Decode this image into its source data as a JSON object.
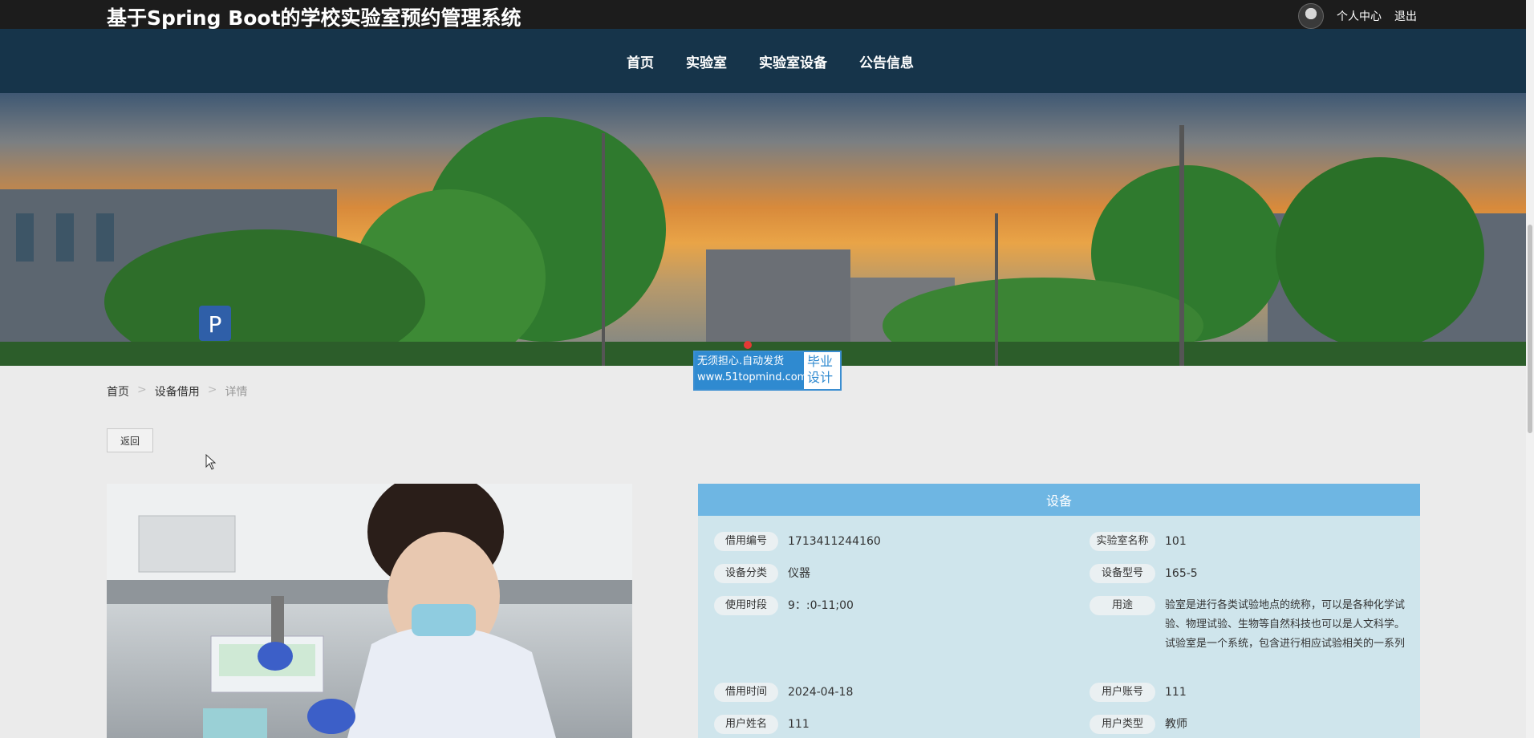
{
  "header": {
    "site_title": "基于Spring Boot的学校实验室预约管理系统",
    "user_center": "个人中心",
    "logout": "退出"
  },
  "nav": {
    "items": [
      {
        "label": "首页"
      },
      {
        "label": "实验室"
      },
      {
        "label": "实验室设备"
      },
      {
        "label": "公告信息"
      }
    ]
  },
  "watermark": {
    "line1": "无须担心.自动发货",
    "line2": "www.51topmind.com",
    "right1": "毕业",
    "right2": "设计"
  },
  "breadcrumb": {
    "home": "首页",
    "section": "设备借用",
    "current": "详情",
    "separator": ">"
  },
  "back_button": "返回",
  "detail": {
    "title": "设备",
    "fields": {
      "borrow_no": {
        "label": "借用编号",
        "value": "1713411244160"
      },
      "lab_name": {
        "label": "实验室名称",
        "value": "101"
      },
      "category": {
        "label": "设备分类",
        "value": "仪器"
      },
      "model": {
        "label": "设备型号",
        "value": "165-5"
      },
      "period": {
        "label": "使用时段",
        "value": "9：:0-11;00"
      },
      "purpose": {
        "label": "用途",
        "value": "验室是进行各类试验地点的统称，可以是各种化学试验、物理试验、生物等自然科技也可以是人文科学。试验室是一个系统，包含进行相应试验相关的一系列"
      },
      "borrow_time": {
        "label": "借用时间",
        "value": "2024-04-18"
      },
      "account": {
        "label": "用户账号",
        "value": "111"
      },
      "user_name": {
        "label": "用户姓名",
        "value": "111"
      },
      "user_type": {
        "label": "用户类型",
        "value": "教师"
      }
    }
  },
  "colors": {
    "topbar": "#1c1c1c",
    "navbar": "#16344a",
    "detail_header": "#6eb6e3",
    "detail_bg": "#cfe5ec"
  }
}
